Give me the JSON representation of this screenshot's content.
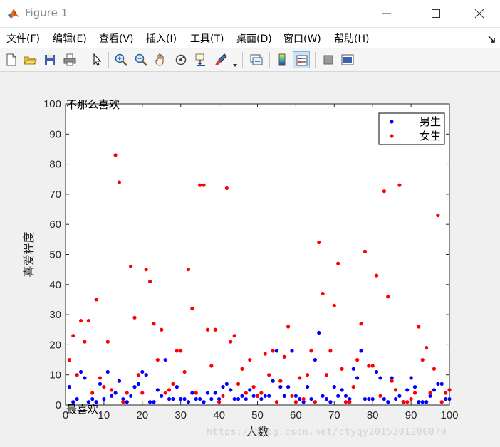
{
  "window": {
    "title": "Figure 1"
  },
  "menu": [
    "文件(F)",
    "编辑(E)",
    "查看(V)",
    "插入(I)",
    "工具(T)",
    "桌面(D)",
    "窗口(W)",
    "帮助(H)"
  ],
  "toolbar": {
    "buttons": [
      {
        "icon": "new-figure-icon"
      },
      {
        "icon": "open-file-icon"
      },
      {
        "icon": "save-icon"
      },
      {
        "icon": "print-icon"
      },
      {
        "icon": "edit-plot-arrow-icon"
      },
      {
        "icon": "zoom-in-icon"
      },
      {
        "icon": "zoom-out-icon"
      },
      {
        "icon": "pan-hand-icon"
      },
      {
        "icon": "rotate-3d-icon"
      },
      {
        "icon": "data-cursor-icon"
      },
      {
        "icon": "brush-icon"
      },
      {
        "icon": "link-plot-icon"
      },
      {
        "icon": "insert-colorbar-icon"
      },
      {
        "icon": "insert-legend-icon"
      },
      {
        "icon": "hide-plot-tools-icon"
      },
      {
        "icon": "show-plot-tools-icon"
      }
    ]
  },
  "colors": {
    "male": "#0000ff",
    "female": "#ff0000"
  },
  "watermark": "https://blog.csdn.net/ctyqy2015301200079",
  "chart_data": {
    "type": "scatter",
    "title": "",
    "xlabel": "人数",
    "ylabel": "喜爱程度",
    "xlim": [
      0,
      100
    ],
    "ylim": [
      0,
      100
    ],
    "xticks": [
      0,
      10,
      20,
      30,
      40,
      50,
      60,
      70,
      80,
      90,
      100
    ],
    "yticks": [
      0,
      10,
      20,
      30,
      40,
      50,
      60,
      70,
      80,
      90,
      100
    ],
    "grid": false,
    "legend_position": "top-right",
    "annotations": [
      {
        "text": "不那么喜欢",
        "x": 0,
        "y": 100
      },
      {
        "text": "最喜欢",
        "x": 0,
        "y": 0
      }
    ],
    "series": [
      {
        "name": "男生",
        "color": "#0000ff",
        "x": [
          1,
          2,
          3,
          4,
          5,
          6,
          7,
          8,
          9,
          10,
          11,
          12,
          13,
          14,
          15,
          16,
          17,
          18,
          19,
          20,
          21,
          22,
          23,
          24,
          25,
          26,
          27,
          28,
          29,
          30,
          31,
          32,
          33,
          34,
          35,
          36,
          37,
          38,
          39,
          40,
          41,
          42,
          43,
          44,
          45,
          46,
          47,
          48,
          49,
          50,
          51,
          52,
          53,
          54,
          55,
          56,
          57,
          58,
          59,
          60,
          61,
          62,
          63,
          64,
          65,
          66,
          67,
          68,
          69,
          70,
          71,
          72,
          73,
          74,
          75,
          76,
          77,
          78,
          79,
          80,
          81,
          82,
          83,
          84,
          85,
          86,
          87,
          88,
          89,
          90,
          91,
          92,
          93,
          94,
          95,
          96,
          97,
          98,
          99,
          100
        ],
        "y": [
          6,
          1,
          2,
          11,
          9,
          1,
          2,
          1,
          7,
          2,
          11,
          3,
          4,
          8,
          2,
          1,
          3,
          6,
          7,
          11,
          10,
          1,
          1,
          5,
          3,
          15,
          2,
          2,
          6,
          2,
          2,
          1,
          4,
          2,
          2,
          1,
          4,
          2,
          4,
          2,
          6,
          7,
          5,
          2,
          2,
          3,
          2,
          5,
          3,
          3,
          2,
          3,
          3,
          8,
          18,
          6,
          3,
          6,
          18,
          3,
          2,
          1,
          6,
          2,
          15,
          24,
          3,
          2,
          1,
          6,
          3,
          5,
          3,
          2,
          12,
          9,
          18,
          2,
          2,
          2,
          11,
          9,
          2,
          1,
          9,
          2,
          3,
          1,
          5,
          9,
          6,
          1,
          1,
          1,
          3,
          5,
          7,
          7,
          2,
          2
        ]
      },
      {
        "name": "女生",
        "color": "#ff0000",
        "x": [
          1,
          2,
          3,
          4,
          5,
          6,
          7,
          8,
          9,
          10,
          11,
          12,
          13,
          14,
          15,
          16,
          17,
          18,
          19,
          20,
          21,
          22,
          23,
          24,
          25,
          26,
          27,
          28,
          29,
          30,
          31,
          32,
          33,
          34,
          35,
          36,
          37,
          38,
          39,
          40,
          41,
          42,
          43,
          44,
          45,
          46,
          47,
          48,
          49,
          50,
          51,
          52,
          53,
          54,
          55,
          56,
          57,
          58,
          59,
          60,
          61,
          62,
          63,
          64,
          65,
          66,
          67,
          68,
          69,
          70,
          71,
          72,
          73,
          74,
          75,
          76,
          77,
          78,
          79,
          80,
          81,
          82,
          83,
          84,
          85,
          86,
          87,
          88,
          89,
          90,
          91,
          92,
          93,
          94,
          95,
          96,
          97,
          98,
          99,
          100
        ],
        "y": [
          15,
          23,
          10,
          28,
          21,
          28,
          4,
          35,
          9,
          6,
          21,
          5,
          83,
          74,
          1,
          4,
          46,
          29,
          10,
          4,
          45,
          41,
          27,
          15,
          25,
          4,
          5,
          7,
          18,
          18,
          11,
          45,
          32,
          4,
          73,
          73,
          25,
          13,
          25,
          1,
          3,
          72,
          21,
          23,
          7,
          12,
          4,
          15,
          6,
          3,
          4,
          17,
          10,
          18,
          1,
          8,
          16,
          26,
          3,
          1,
          9,
          2,
          10,
          18,
          1,
          54,
          37,
          10,
          18,
          33,
          47,
          12,
          1,
          1,
          6,
          15,
          27,
          51,
          13,
          13,
          43,
          3,
          71,
          36,
          8,
          5,
          73,
          1,
          1,
          2,
          4,
          26,
          15,
          19,
          4,
          12,
          63,
          1,
          4,
          5
        ]
      }
    ]
  }
}
